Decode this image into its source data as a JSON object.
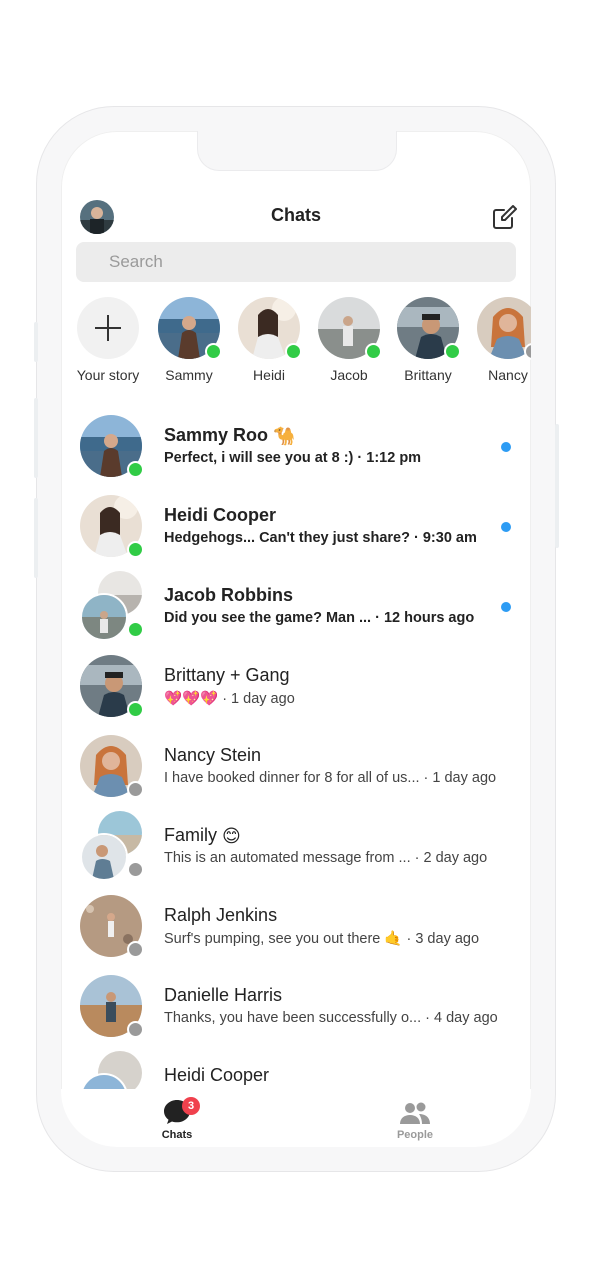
{
  "header": {
    "title": "Chats"
  },
  "search": {
    "placeholder": "Search"
  },
  "stories": [
    {
      "name": "Your story",
      "type": "add"
    },
    {
      "name": "Sammy",
      "status": "online"
    },
    {
      "name": "Heidi",
      "status": "online"
    },
    {
      "name": "Jacob",
      "status": "online"
    },
    {
      "name": "Brittany",
      "status": "online"
    },
    {
      "name": "Nancy",
      "status": "offline"
    }
  ],
  "chats": [
    {
      "name": "Sammy Roo",
      "name_emoji": "🐪",
      "message": "Perfect, i will see you at 8 :)",
      "time": "· 1:12 pm",
      "unread": true,
      "status": "online"
    },
    {
      "name": "Heidi Cooper",
      "message": "Hedgehogs... Can't they just share?",
      "time": "· 9:30 am",
      "unread": true,
      "status": "online"
    },
    {
      "name": "Jacob Robbins",
      "message": "Did you see the game? Man ...",
      "time": "· 12 hours ago",
      "unread": true,
      "status": "online",
      "group": true
    },
    {
      "name": "Brittany + Gang",
      "message": "💖💖💖",
      "time": "· 1 day ago",
      "unread": false,
      "status": "online"
    },
    {
      "name": "Nancy Stein",
      "message": "I have booked dinner for 8 for all of us...",
      "time": "· 1 day ago",
      "unread": false,
      "status": "offline"
    },
    {
      "name": "Family",
      "name_emoji": "😊",
      "message": "This is an automated message from ...",
      "time": "· 2 day ago",
      "unread": false,
      "status": "offline",
      "group": true
    },
    {
      "name": "Ralph Jenkins",
      "message": "Surf's pumping, see you out there 🤙",
      "time": "· 3 day ago",
      "unread": false,
      "status": "offline"
    },
    {
      "name": "Danielle Harris",
      "message": "Thanks, you have been successfully o...",
      "time": "· 4 day ago",
      "unread": false,
      "status": "offline"
    },
    {
      "name": "Heidi Cooper",
      "message": "",
      "time": "",
      "unread": false,
      "status": "offline",
      "group": true
    }
  ],
  "tabs": {
    "chats_label": "Chats",
    "chats_badge": "3",
    "people_label": "People"
  },
  "colors": {
    "online": "#31cc46",
    "offline": "#9a9a9a",
    "badge": "#f0414d",
    "unread_dot": "#2d9cf4"
  }
}
